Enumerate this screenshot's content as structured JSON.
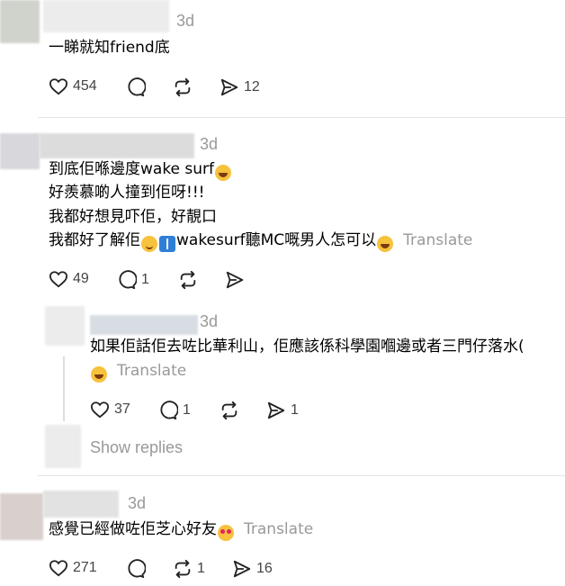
{
  "comments": [
    {
      "time": "3d",
      "lines": [
        "一睇就知friend底"
      ],
      "likes": "454",
      "replies": "",
      "reposts": "",
      "shares": "12"
    },
    {
      "time": "3d",
      "lines": [
        "到底佢喺邊度wake surf",
        "好羨慕啲人撞到佢呀!!!",
        "我都好想見吓佢，好靚口",
        "我都好了解佢"
      ],
      "line4_mid": "wakesurf聽MC嘅男人怎可以",
      "translate": "Translate",
      "likes": "49",
      "replies": "1",
      "reposts": "",
      "shares": ""
    },
    {
      "time": "3d",
      "lines": [
        "如果佢話佢去咗比華利山，佢應該係科學園嗰邊或者三門仔落水("
      ],
      "translate": "Translate",
      "likes": "37",
      "replies": "1",
      "reposts": "",
      "shares": "1",
      "show_replies": "Show replies"
    },
    {
      "time": "3d",
      "lines": [
        "感覺已經做咗佢芝心好友"
      ],
      "translate": "Translate",
      "likes": "271",
      "replies": "",
      "reposts": "1",
      "shares": "16"
    }
  ],
  "icons": {
    "like": "heart-icon",
    "reply": "comment-bubble-icon",
    "repost": "repost-icon",
    "share": "share-icon"
  },
  "colors": {
    "meta_gray": "#999999",
    "divider": "#e3e3e3"
  }
}
